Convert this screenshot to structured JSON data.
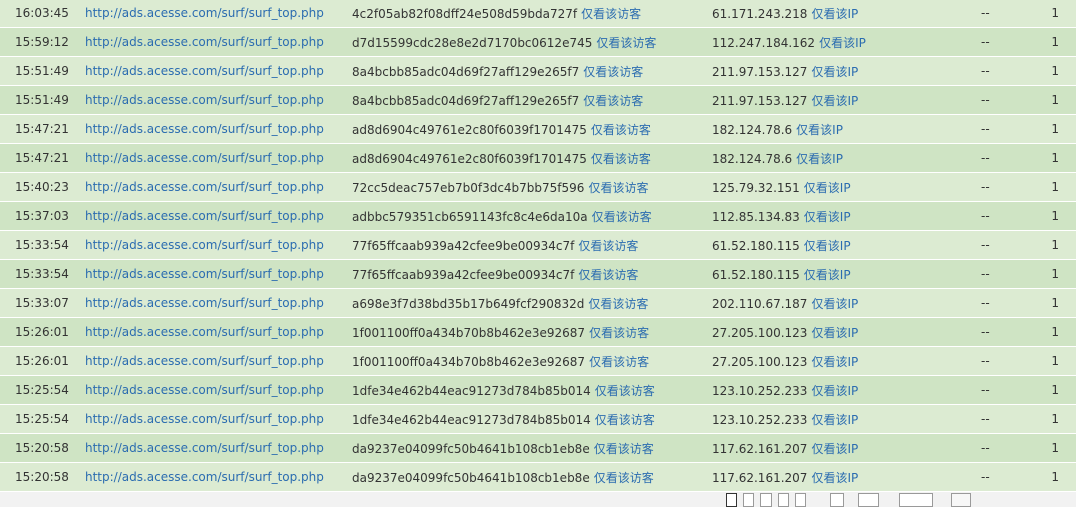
{
  "rows": [
    {
      "time": "16:03:45",
      "url": "http://ads.acesse.com/surf/surf_top.php",
      "visitor_id": "4c2f05ab82f08dff24e508d59bda727f",
      "visitor_link": "仅看该访客",
      "ip": "61.171.243.218",
      "ip_link": "仅看该IP",
      "source": "--",
      "count": "1"
    },
    {
      "time": "15:59:12",
      "url": "http://ads.acesse.com/surf/surf_top.php",
      "visitor_id": "d7d15599cdc28e8e2d7170bc0612e745",
      "visitor_link": "仅看该访客",
      "ip": "112.247.184.162",
      "ip_link": "仅看该IP",
      "source": "--",
      "count": "1"
    },
    {
      "time": "15:51:49",
      "url": "http://ads.acesse.com/surf/surf_top.php",
      "visitor_id": "8a4bcbb85adc04d69f27aff129e265f7",
      "visitor_link": "仅看该访客",
      "ip": "211.97.153.127",
      "ip_link": "仅看该IP",
      "source": "--",
      "count": "1"
    },
    {
      "time": "15:51:49",
      "url": "http://ads.acesse.com/surf/surf_top.php",
      "visitor_id": "8a4bcbb85adc04d69f27aff129e265f7",
      "visitor_link": "仅看该访客",
      "ip": "211.97.153.127",
      "ip_link": "仅看该IP",
      "source": "--",
      "count": "1"
    },
    {
      "time": "15:47:21",
      "url": "http://ads.acesse.com/surf/surf_top.php",
      "visitor_id": "ad8d6904c49761e2c80f6039f1701475",
      "visitor_link": "仅看该访客",
      "ip": "182.124.78.6",
      "ip_link": "仅看该IP",
      "source": "--",
      "count": "1"
    },
    {
      "time": "15:47:21",
      "url": "http://ads.acesse.com/surf/surf_top.php",
      "visitor_id": "ad8d6904c49761e2c80f6039f1701475",
      "visitor_link": "仅看该访客",
      "ip": "182.124.78.6",
      "ip_link": "仅看该IP",
      "source": "--",
      "count": "1"
    },
    {
      "time": "15:40:23",
      "url": "http://ads.acesse.com/surf/surf_top.php",
      "visitor_id": "72cc5deac757eb7b0f3dc4b7bb75f596",
      "visitor_link": "仅看该访客",
      "ip": "125.79.32.151",
      "ip_link": "仅看该IP",
      "source": "--",
      "count": "1"
    },
    {
      "time": "15:37:03",
      "url": "http://ads.acesse.com/surf/surf_top.php",
      "visitor_id": "adbbc579351cb6591143fc8c4e6da10a",
      "visitor_link": "仅看该访客",
      "ip": "112.85.134.83",
      "ip_link": "仅看该IP",
      "source": "--",
      "count": "1"
    },
    {
      "time": "15:33:54",
      "url": "http://ads.acesse.com/surf/surf_top.php",
      "visitor_id": "77f65ffcaab939a42cfee9be00934c7f",
      "visitor_link": "仅看该访客",
      "ip": "61.52.180.115",
      "ip_link": "仅看该IP",
      "source": "--",
      "count": "1"
    },
    {
      "time": "15:33:54",
      "url": "http://ads.acesse.com/surf/surf_top.php",
      "visitor_id": "77f65ffcaab939a42cfee9be00934c7f",
      "visitor_link": "仅看该访客",
      "ip": "61.52.180.115",
      "ip_link": "仅看该IP",
      "source": "--",
      "count": "1"
    },
    {
      "time": "15:33:07",
      "url": "http://ads.acesse.com/surf/surf_top.php",
      "visitor_id": "a698e3f7d38bd35b17b649fcf290832d",
      "visitor_link": "仅看该访客",
      "ip": "202.110.67.187",
      "ip_link": "仅看该IP",
      "source": "--",
      "count": "1"
    },
    {
      "time": "15:26:01",
      "url": "http://ads.acesse.com/surf/surf_top.php",
      "visitor_id": "1f001100ff0a434b70b8b462e3e92687",
      "visitor_link": "仅看该访客",
      "ip": "27.205.100.123",
      "ip_link": "仅看该IP",
      "source": "--",
      "count": "1"
    },
    {
      "time": "15:26:01",
      "url": "http://ads.acesse.com/surf/surf_top.php",
      "visitor_id": "1f001100ff0a434b70b8b462e3e92687",
      "visitor_link": "仅看该访客",
      "ip": "27.205.100.123",
      "ip_link": "仅看该IP",
      "source": "--",
      "count": "1"
    },
    {
      "time": "15:25:54",
      "url": "http://ads.acesse.com/surf/surf_top.php",
      "visitor_id": "1dfe34e462b44eac91273d784b85b014",
      "visitor_link": "仅看该访客",
      "ip": "123.10.252.233",
      "ip_link": "仅看该IP",
      "source": "--",
      "count": "1"
    },
    {
      "time": "15:25:54",
      "url": "http://ads.acesse.com/surf/surf_top.php",
      "visitor_id": "1dfe34e462b44eac91273d784b85b014",
      "visitor_link": "仅看该访客",
      "ip": "123.10.252.233",
      "ip_link": "仅看该IP",
      "source": "--",
      "count": "1"
    },
    {
      "time": "15:20:58",
      "url": "http://ads.acesse.com/surf/surf_top.php",
      "visitor_id": "da9237e04099fc50b4641b108cb1eb8e",
      "visitor_link": "仅看该访客",
      "ip": "117.62.161.207",
      "ip_link": "仅看该IP",
      "source": "--",
      "count": "1"
    },
    {
      "time": "15:20:58",
      "url": "http://ads.acesse.com/surf/surf_top.php",
      "visitor_id": "da9237e04099fc50b4641b108cb1eb8e",
      "visitor_link": "仅看该访客",
      "ip": "117.62.161.207",
      "ip_link": "仅看该IP",
      "source": "--",
      "count": "1"
    }
  ],
  "colors": {
    "row_even": "#dcebd2",
    "row_odd": "#cfe4c4",
    "link": "#2b6cb0"
  }
}
